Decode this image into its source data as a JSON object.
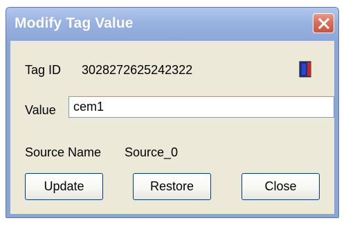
{
  "window": {
    "title": "Modify Tag Value"
  },
  "tag": {
    "id_label": "Tag ID",
    "id_value": "3028272625242322"
  },
  "value_field": {
    "label": "Value",
    "value": "cem1"
  },
  "source": {
    "label": "Source Name",
    "value": "Source_0"
  },
  "buttons": {
    "update": "Update",
    "restore": "Restore",
    "close": "Close"
  },
  "icons": {
    "window_close": "close-icon",
    "tag": "tag-icon"
  },
  "colors": {
    "titlebar": "#8ca6d8",
    "close_button": "#d96f5c",
    "dialog_background": "#ece9d8",
    "input_border": "#7f9db9"
  }
}
